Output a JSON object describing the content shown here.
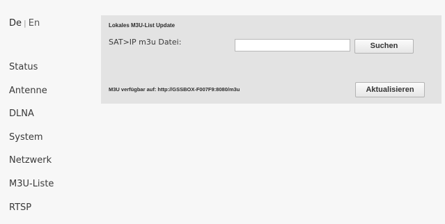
{
  "language": {
    "active": "De",
    "separator": "|",
    "other": "En"
  },
  "nav": {
    "items": [
      {
        "label": "Status"
      },
      {
        "label": "Antenne"
      },
      {
        "label": "DLNA"
      },
      {
        "label": "System"
      },
      {
        "label": "Netzwerk"
      },
      {
        "label": "M3U-Liste"
      },
      {
        "label": "RTSP"
      }
    ]
  },
  "panel": {
    "title": "Lokales M3U-List Update",
    "sat_label": "SAT>IP m3u Datei:",
    "file_input_value": "",
    "search_button": "Suchen",
    "availability_text": "M3U verfügbar auf: http://GSSBOX-F007F9:8080/m3u",
    "update_button": "Aktualisieren"
  },
  "colors": {
    "page_background": "#f7f7f7",
    "panel_background": "#e3e3e3",
    "text": "#3a3a3a"
  }
}
